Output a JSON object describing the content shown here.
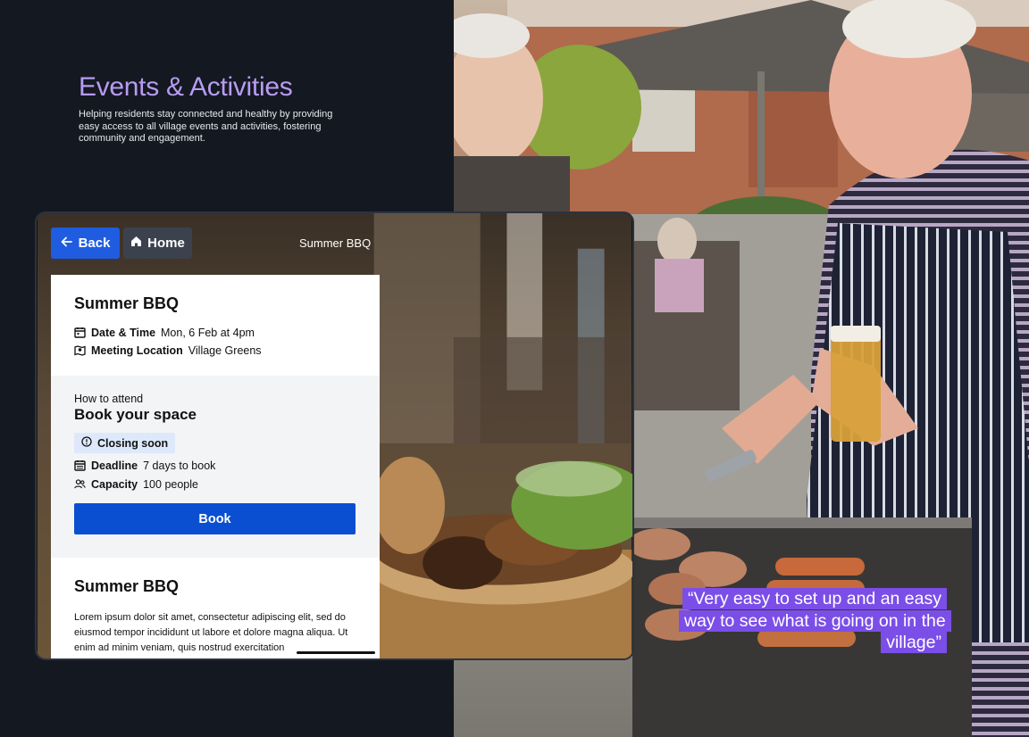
{
  "hero": {
    "title": "Events & Activities",
    "description": "Helping residents stay connected and healthy by providing easy access to all village events and activities, fostering community and engagement."
  },
  "quote": {
    "text": "“Very easy to set up and an easy way to see what is going on in the village”"
  },
  "tablet": {
    "nav": {
      "back_label": "Back",
      "home_label": "Home",
      "title": "Summer BBQ"
    },
    "event": {
      "title": "Summer BBQ",
      "date_label": "Date & Time",
      "date_value": "Mon, 6 Feb at 4pm",
      "location_label": "Meeting Location",
      "location_value": "Village Greens"
    },
    "attend": {
      "eyebrow": "How to attend",
      "heading": "Book your space",
      "badge": "Closing soon",
      "deadline_label": "Deadline",
      "deadline_value": "7 days to book",
      "capacity_label": "Capacity",
      "capacity_value": "100 people",
      "book_label": "Book"
    },
    "about": {
      "title": "Summer BBQ",
      "body": "Lorem ipsum dolor sit amet, consectetur adipiscing elit, sed do eiusmod tempor incididunt ut labore et dolore magna aliqua. Ut enim ad minim veniam, quis nostrud exercitation"
    }
  },
  "colors": {
    "page_background": "#141821",
    "hero_title": "#b79cf2",
    "primary_button": "#1f5ce0",
    "book_button": "#0a4fd1",
    "home_button": "#3b424d",
    "quote_highlight": "#7b4ee8",
    "badge_background": "#dde9fb"
  },
  "icons": {
    "back": "arrow-left-icon",
    "home": "home-icon",
    "date": "calendar-icon",
    "location": "map-pin-icon",
    "badge": "info-circle-icon",
    "deadline": "calendar-icon",
    "capacity": "people-icon"
  }
}
